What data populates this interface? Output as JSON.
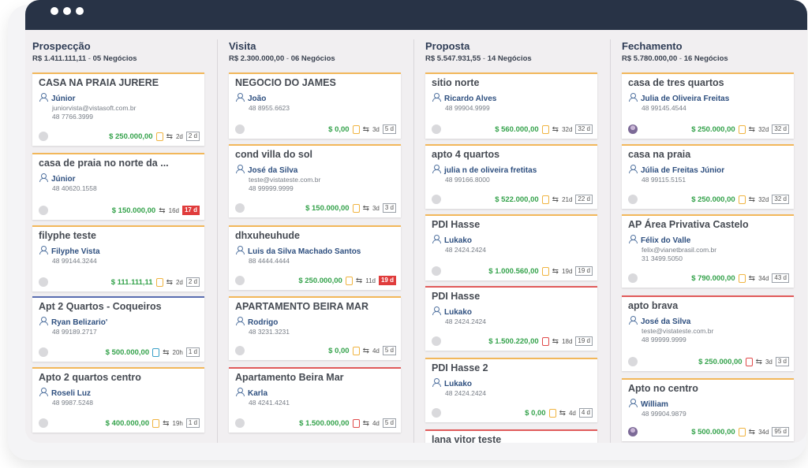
{
  "columns": [
    {
      "title": "Prospecção",
      "total": "R$ 1.411.111,11",
      "count_label": "05 Negócios",
      "cards": [
        {
          "title": "CASA NA PRAIA JURERE",
          "contact": "Júnior",
          "email": "juniorvista@vistasoft.com.br",
          "phone": "48 7766.3999",
          "value": "$ 250.000,00",
          "time": "2d",
          "badge": "2 d",
          "badge_alert": false,
          "clip": "orange",
          "accent": "orange",
          "avatar": "plain"
        },
        {
          "title": "casa de praia no norte da ...",
          "contact": "Júnior",
          "email": "",
          "phone": "48 40620.1558",
          "value": "$ 150.000,00",
          "time": "16d",
          "badge": "17 d",
          "badge_alert": true,
          "clip": "none",
          "accent": "orange",
          "avatar": "plain"
        },
        {
          "title": "filyphe teste",
          "contact": "Filyphe Vista",
          "email": "",
          "phone": "48 99144.3244",
          "value": "$ 111.111,11",
          "time": "2d",
          "badge": "2 d",
          "badge_alert": false,
          "clip": "orange",
          "accent": "orange",
          "avatar": "plain"
        },
        {
          "title": "Apt 2 Quartos - Coqueiros",
          "contact": "Ryan Belizario'",
          "email": "",
          "phone": "48 99189.2717",
          "value": "$ 500.000,00",
          "time": "20h",
          "badge": "1 d",
          "badge_alert": false,
          "clip": "blue",
          "accent": "blue",
          "avatar": "plain"
        },
        {
          "title": "Apto 2 quartos centro",
          "contact": "Roseli Luz",
          "email": "",
          "phone": "48 9987.5248",
          "value": "$ 400.000,00",
          "time": "19h",
          "badge": "1 d",
          "badge_alert": false,
          "clip": "orange",
          "accent": "orange",
          "avatar": "plain"
        }
      ]
    },
    {
      "title": "Visita",
      "total": "R$ 2.300.000,00",
      "count_label": "06 Negócios",
      "cards": [
        {
          "title": "NEGOCIO DO JAMES",
          "contact": "João",
          "email": "",
          "phone": "48 8955.6623",
          "value": "$ 0,00",
          "time": "3d",
          "badge": "5 d",
          "badge_alert": false,
          "clip": "orange",
          "accent": "orange",
          "avatar": "plain"
        },
        {
          "title": "cond villa do sol",
          "contact": "José da Silva",
          "email": "teste@vistateste.com.br",
          "phone": "48 99999.9999",
          "value": "$ 150.000,00",
          "time": "3d",
          "badge": "3 d",
          "badge_alert": false,
          "clip": "orange",
          "accent": "orange",
          "avatar": "plain"
        },
        {
          "title": "dhxuheuhude",
          "contact": "Luis da Silva Machado Santos",
          "email": "",
          "phone": "88 4444.4444",
          "value": "$ 250.000,00",
          "time": "11d",
          "badge": "19 d",
          "badge_alert": true,
          "clip": "orange",
          "accent": "orange",
          "avatar": "plain"
        },
        {
          "title": "APARTAMENTO BEIRA MAR",
          "contact": "Rodrigo",
          "email": "",
          "phone": "48 3231.3231",
          "value": "$ 0,00",
          "time": "4d",
          "badge": "5 d",
          "badge_alert": false,
          "clip": "orange",
          "accent": "orange",
          "avatar": "plain"
        },
        {
          "title": "Apartamento Beira Mar",
          "contact": "Karla",
          "email": "",
          "phone": "48 4241.4241",
          "value": "$ 1.500.000,00",
          "time": "4d",
          "badge": "5 d",
          "badge_alert": false,
          "clip": "red",
          "accent": "red",
          "avatar": "plain"
        }
      ]
    },
    {
      "title": "Proposta",
      "total": "R$ 5.547.931,55",
      "count_label": "14 Negócios",
      "cards": [
        {
          "title": "sitio norte",
          "contact": "Ricardo Alves",
          "email": "",
          "phone": "48 99904.9999",
          "value": "$ 560.000,00",
          "time": "32d",
          "badge": "32 d",
          "badge_alert": false,
          "clip": "orange",
          "accent": "orange",
          "avatar": "plain"
        },
        {
          "title": "apto 4 quartos",
          "contact": "julia n de oliveira fretitas",
          "email": "",
          "phone": "48 99166.8000",
          "value": "$ 522.000,00",
          "time": "21d",
          "badge": "22 d",
          "badge_alert": false,
          "clip": "orange",
          "accent": "orange",
          "avatar": "plain"
        },
        {
          "title": "PDI Hasse",
          "contact": "Lukako",
          "email": "",
          "phone": "48 2424.2424",
          "value": "$ 1.000.560,00",
          "time": "19d",
          "badge": "19 d",
          "badge_alert": false,
          "clip": "orange",
          "accent": "orange",
          "avatar": "plain"
        },
        {
          "title": "PDI Hasse",
          "contact": "Lukako",
          "email": "",
          "phone": "48 2424.2424",
          "value": "$ 1.500.220,00",
          "time": "18d",
          "badge": "19 d",
          "badge_alert": false,
          "clip": "red",
          "accent": "red",
          "avatar": "plain"
        },
        {
          "title": "PDI Hasse 2",
          "contact": "Lukako",
          "email": "",
          "phone": "48 2424.2424",
          "value": "$ 0,00",
          "time": "4d",
          "badge": "4 d",
          "badge_alert": false,
          "clip": "orange",
          "accent": "orange",
          "avatar": "plain"
        }
      ]
    },
    {
      "title": "Fechamento",
      "total": "R$ 5.780.000,00",
      "count_label": "16 Negócios",
      "cards": [
        {
          "title": "casa de tres quartos",
          "contact": "Julia de Oliveira Freitas",
          "email": "",
          "phone": "48 99145.4544",
          "value": "$ 250.000,00",
          "time": "32d",
          "badge": "32 d",
          "badge_alert": false,
          "clip": "orange",
          "accent": "orange",
          "avatar": "photo"
        },
        {
          "title": "casa na praia",
          "contact": "Júlia de Freitas Júnior",
          "email": "",
          "phone": "48 99115.5151",
          "value": "$ 250.000,00",
          "time": "32d",
          "badge": "32 d",
          "badge_alert": false,
          "clip": "orange",
          "accent": "orange",
          "avatar": "plain"
        },
        {
          "title": "AP Área Privativa Castelo",
          "contact": "Félix do Valle",
          "email": "felix@vianetbrasil.com.br",
          "phone": "31 3499.5050",
          "value": "$ 790.000,00",
          "time": "34d",
          "badge": "43 d",
          "badge_alert": false,
          "clip": "orange",
          "accent": "orange",
          "avatar": "plain"
        },
        {
          "title": "apto brava",
          "contact": "José da Silva",
          "email": "teste@vistateste.com.br",
          "phone": "48 99999.9999",
          "value": "$ 250.000,00",
          "time": "3d",
          "badge": "3 d",
          "badge_alert": false,
          "clip": "red",
          "accent": "red",
          "avatar": "plain"
        },
        {
          "title": "Apto no centro",
          "contact": "William",
          "email": "",
          "phone": "48 99904.9879",
          "value": "$ 500.000,00",
          "time": "34d",
          "badge": "95 d",
          "badge_alert": false,
          "clip": "orange",
          "accent": "orange",
          "avatar": "photo"
        }
      ]
    }
  ],
  "partial_card_title": "lana vitor teste",
  "colors": {
    "titlebar": "#283346",
    "value_green": "#34a24b",
    "accent_orange": "#f2b75a",
    "accent_red": "#e05a5a",
    "accent_blue": "#5a6db0"
  }
}
